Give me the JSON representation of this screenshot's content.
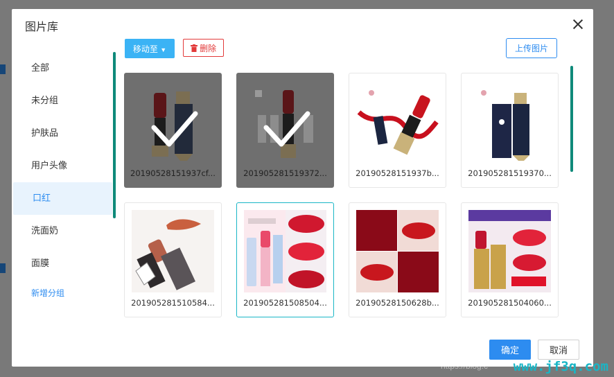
{
  "dialog": {
    "title": "图片库",
    "close_icon": "close-icon"
  },
  "sidebar": {
    "items": [
      {
        "label": "全部"
      },
      {
        "label": "未分组"
      },
      {
        "label": "护肤品"
      },
      {
        "label": "用户头像"
      },
      {
        "label": "口红",
        "active": true
      },
      {
        "label": "洗面奶"
      },
      {
        "label": "面膜"
      }
    ],
    "add_label": "新增分组"
  },
  "toolbar": {
    "move_label": "移动至",
    "move_icon": "caret-down-icon",
    "delete_label": "删除",
    "delete_icon": "trash-icon",
    "upload_label": "上传图片"
  },
  "images": [
    {
      "name": "20190528151937cf...",
      "selected": true
    },
    {
      "name": "201905281519372...",
      "selected": true
    },
    {
      "name": "20190528151937b...",
      "selected": false
    },
    {
      "name": "201905281519370...",
      "selected": false
    },
    {
      "name": "201905281510584...",
      "selected": false
    },
    {
      "name": "201905281508504...",
      "selected": false,
      "highlighted": true
    },
    {
      "name": "20190528150628b...",
      "selected": false
    },
    {
      "name": "201905281504060...",
      "selected": false
    }
  ],
  "footer": {
    "ok_label": "确定",
    "cancel_label": "取消"
  },
  "watermark": {
    "text": "www.jf3q.com",
    "faint_text": "https://blog.c"
  },
  "colors": {
    "primary": "#2d8cf0",
    "move_button": "#3bb3f5",
    "danger": "#e23a3a",
    "scrollbar": "#0f8a7a"
  }
}
